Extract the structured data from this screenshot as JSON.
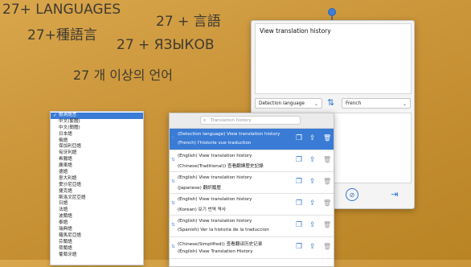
{
  "promo": {
    "line1": "27+ LANGUAGES",
    "line2": "27+種語言",
    "line3": "27 + 言語",
    "line4": "27 + ЯЗЫКОВ",
    "line5": "27 개 이상의 언어"
  },
  "language_list": {
    "items": [
      "檢測語言",
      "中文(繁體)",
      "中文(簡體)",
      "日本語",
      "俄語",
      "保加利亞語",
      "匈牙利語",
      "希臘語",
      "廣東語",
      "德語",
      "意大利語",
      "愛沙尼亞語",
      "捷克語",
      "斯洛文尼亞語",
      "日語",
      "法語",
      "波蘭語",
      "泰語",
      "瑞典語",
      "羅馬尼亞語",
      "芬蘭語",
      "荷蘭語",
      "葡萄牙語"
    ],
    "selected": "檢測語言"
  },
  "translator": {
    "source_text": "View translation history",
    "source_language": "Detection language",
    "target_language": "French",
    "swap_icon": "swap-arrows-icon",
    "copy_icon": "compass-icon",
    "exit_icon": "exit-icon"
  },
  "history": {
    "search_placeholder": "Translation history",
    "rows": [
      {
        "line1": "(Detection language) View translation history",
        "line2": "(French) l'historie vue traduction",
        "active": true
      },
      {
        "line1": "(English) View translation history",
        "line2": "(Chinese(Traditional)) 查看翻譯歷史記錄",
        "active": false
      },
      {
        "line1": "(English) View translation history",
        "line2": "(Japanese) 翻訳履歴",
        "active": false
      },
      {
        "line1": "(English) View translation history",
        "line2": "(Korean) 보기 번역 역사",
        "active": false
      },
      {
        "line1": "(English) View translation history",
        "line2": "(Spanish) Ver la historia de la traduccion",
        "active": false
      },
      {
        "line1": "(Chinese(Simplified)) 查看翻译历史记录",
        "line2": "(English) View Translation History",
        "active": false
      }
    ]
  },
  "colors": {
    "accent": "#2f76d2",
    "selection": "#3a7bd5"
  }
}
